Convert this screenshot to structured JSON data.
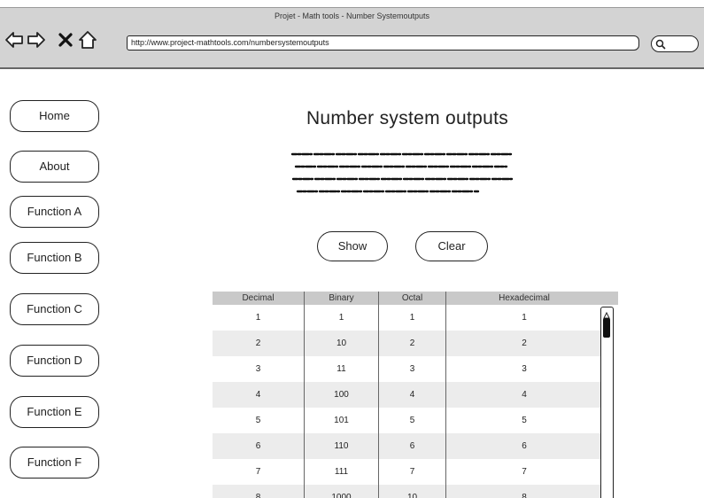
{
  "window": {
    "title": "Projet - Math tools - Number Systemoutputs"
  },
  "browser": {
    "url": "http://www.project-mathtools.com/numbersystemoutputs",
    "icons": [
      "back-arrow-icon",
      "forward-arrow-icon",
      "close-x-icon",
      "home-icon",
      "search-icon"
    ]
  },
  "sidebar": {
    "items": [
      {
        "label": "Home"
      },
      {
        "label": "About"
      },
      {
        "label": "Function A"
      },
      {
        "label": "Function B"
      },
      {
        "label": "Function C"
      },
      {
        "label": "Function D"
      },
      {
        "label": "Function E"
      },
      {
        "label": "Function F"
      }
    ]
  },
  "main": {
    "title": "Number system outputs",
    "show_label": "Show",
    "clear_label": "Clear"
  },
  "table": {
    "headers": [
      "Decimal",
      "Binary",
      "Octal",
      "Hexadecimal"
    ],
    "rows": [
      [
        "1",
        "1",
        "1",
        "1"
      ],
      [
        "2",
        "10",
        "2",
        "2"
      ],
      [
        "3",
        "11",
        "3",
        "3"
      ],
      [
        "4",
        "100",
        "4",
        "4"
      ],
      [
        "5",
        "101",
        "5",
        "5"
      ],
      [
        "6",
        "110",
        "6",
        "6"
      ],
      [
        "7",
        "111",
        "7",
        "7"
      ],
      [
        "8",
        "1000",
        "10",
        "8"
      ]
    ]
  }
}
